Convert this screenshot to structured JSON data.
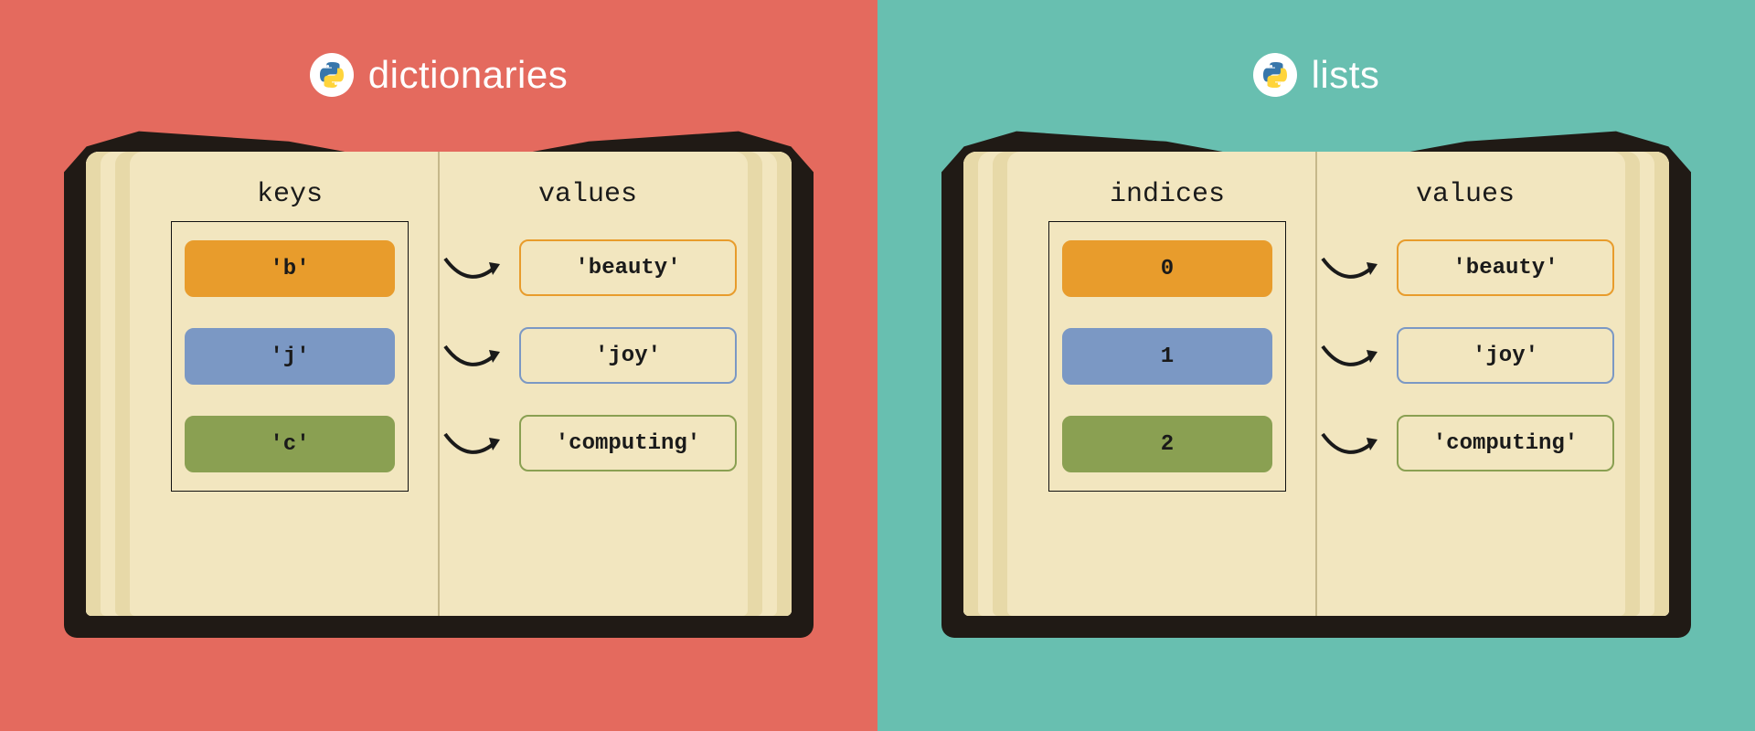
{
  "left": {
    "title": "dictionaries",
    "left_heading": "keys",
    "right_heading": "values",
    "rows": [
      {
        "key": "'b'",
        "value": "'beauty'",
        "color": "orange"
      },
      {
        "key": "'j'",
        "value": "'joy'",
        "color": "blue"
      },
      {
        "key": "'c'",
        "value": "'computing'",
        "color": "green"
      }
    ]
  },
  "right": {
    "title": "lists",
    "left_heading": "indices",
    "right_heading": "values",
    "rows": [
      {
        "key": "0",
        "value": "'beauty'",
        "color": "orange"
      },
      {
        "key": "1",
        "value": "'joy'",
        "color": "blue"
      },
      {
        "key": "2",
        "value": "'computing'",
        "color": "green"
      }
    ]
  },
  "colors": {
    "left_bg": "#E46A5E",
    "right_bg": "#68BFB0",
    "orange": "#E89C2C",
    "blue": "#7B98C4",
    "green": "#8AA052",
    "page": "#F2E6BF",
    "cover": "#201A15"
  }
}
